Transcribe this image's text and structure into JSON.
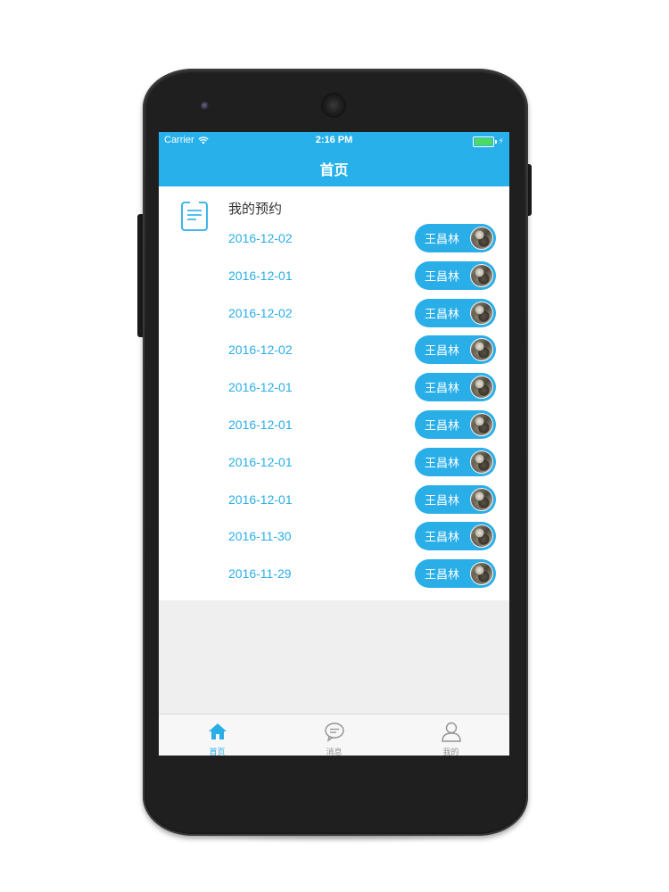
{
  "status_bar": {
    "carrier": "Carrier",
    "time": "2:16 PM",
    "battery_color": "#4cd964"
  },
  "navbar": {
    "title": "首页",
    "color": "#27b0ea"
  },
  "section": {
    "icon": "clipboard-icon",
    "title": "我的预约"
  },
  "appointments": [
    {
      "date": "2016-12-02",
      "name": "王昌林"
    },
    {
      "date": "2016-12-01",
      "name": "王昌林"
    },
    {
      "date": "2016-12-02",
      "name": "王昌林"
    },
    {
      "date": "2016-12-02",
      "name": "王昌林"
    },
    {
      "date": "2016-12-01",
      "name": "王昌林"
    },
    {
      "date": "2016-12-01",
      "name": "王昌林"
    },
    {
      "date": "2016-12-01",
      "name": "王昌林"
    },
    {
      "date": "2016-12-01",
      "name": "王昌林"
    },
    {
      "date": "2016-11-30",
      "name": "王昌林"
    },
    {
      "date": "2016-11-29",
      "name": "王昌林"
    }
  ],
  "tabbar": {
    "tabs": [
      {
        "label": "首页",
        "icon": "home-icon",
        "active": true
      },
      {
        "label": "消息",
        "icon": "message-icon",
        "active": false
      },
      {
        "label": "我的",
        "icon": "person-icon",
        "active": false
      }
    ],
    "active_color": "#29aee8",
    "inactive_color": "#929292"
  }
}
